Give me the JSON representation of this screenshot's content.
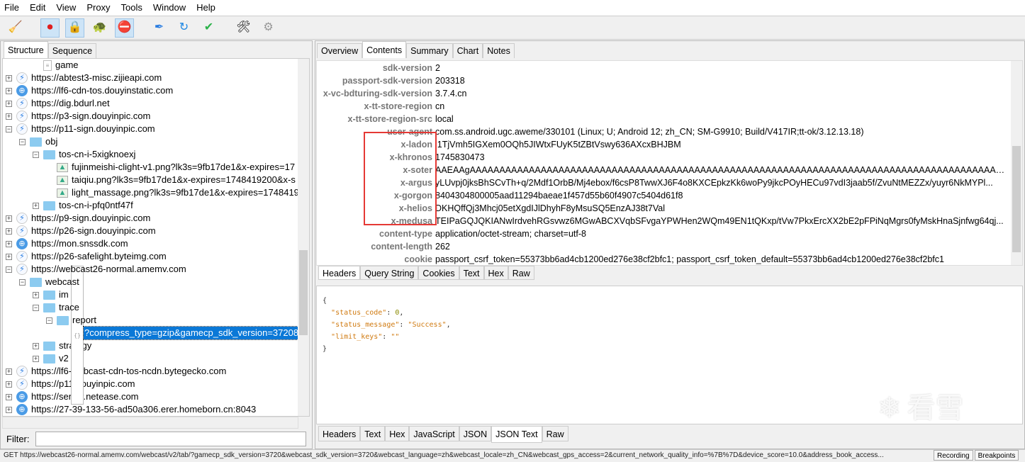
{
  "menu": [
    "File",
    "Edit",
    "View",
    "Proxy",
    "Tools",
    "Window",
    "Help"
  ],
  "toolbar": [
    {
      "icon": "broom-icon",
      "glyph": "🧹",
      "on": false
    },
    {
      "icon": "record-icon",
      "glyph": "⏺",
      "on": true,
      "color": "#e02020"
    },
    {
      "icon": "ssl-lock-icon",
      "glyph": "🔒",
      "on": true
    },
    {
      "icon": "throttle-turtle-icon",
      "glyph": "🐢",
      "on": false
    },
    {
      "icon": "breakpoint-stop-icon",
      "glyph": "⛔",
      "on": true
    },
    {
      "icon": "compose-pen-icon",
      "glyph": "✒",
      "on": false,
      "color": "#2a7de1"
    },
    {
      "icon": "repeat-refresh-icon",
      "glyph": "↻",
      "on": false,
      "color": "#1b86e3"
    },
    {
      "icon": "validate-check-icon",
      "glyph": "✔",
      "on": false,
      "color": "#2cb34a"
    },
    {
      "icon": "tools-icon",
      "glyph": "🛠",
      "on": false
    },
    {
      "icon": "settings-gear-icon",
      "glyph": "⚙",
      "on": false,
      "color": "#999"
    }
  ],
  "left": {
    "tabs": [
      "Structure",
      "Sequence"
    ],
    "tree": [
      {
        "label": "game",
        "level": 2,
        "exp": "",
        "icon": "doc"
      },
      {
        "label": "https://abtest3-misc.zijieapi.com",
        "level": 0,
        "exp": "+",
        "icon": "bolt"
      },
      {
        "label": "https://lf6-cdn-tos.douyinstatic.com",
        "level": 0,
        "exp": "+",
        "icon": "globe"
      },
      {
        "label": "https://dig.bdurl.net",
        "level": 0,
        "exp": "+",
        "icon": "bolt"
      },
      {
        "label": "https://p3-sign.douyinpic.com",
        "level": 0,
        "exp": "+",
        "icon": "bolt"
      },
      {
        "label": "https://p11-sign.douyinpic.com",
        "level": 0,
        "exp": "−",
        "icon": "bolt"
      },
      {
        "label": "obj",
        "level": 1,
        "exp": "−",
        "icon": "folder"
      },
      {
        "label": "tos-cn-i-5xigknoexj",
        "level": 2,
        "exp": "−",
        "icon": "folder"
      },
      {
        "label": "fujinmeishi-clight-v1.png?lk3s=9fb17de1&x-expires=17",
        "level": 3,
        "exp": "",
        "icon": "image"
      },
      {
        "label": "taiqiu.png?lk3s=9fb17de1&x-expires=1748419200&x-s",
        "level": 3,
        "exp": "",
        "icon": "image"
      },
      {
        "label": "light_massage.png?lk3s=9fb17de1&x-expires=1748419",
        "level": 3,
        "exp": "",
        "icon": "image"
      },
      {
        "label": "tos-cn-i-pfq0ntf47f",
        "level": 2,
        "exp": "+",
        "icon": "folder"
      },
      {
        "label": "https://p9-sign.douyinpic.com",
        "level": 0,
        "exp": "+",
        "icon": "bolt"
      },
      {
        "label": "https://p26-sign.douyinpic.com",
        "level": 0,
        "exp": "+",
        "icon": "bolt"
      },
      {
        "label": "https://mon.snssdk.com",
        "level": 0,
        "exp": "+",
        "icon": "globe"
      },
      {
        "label": "https://p26-safelight.byteimg.com",
        "level": 0,
        "exp": "+",
        "icon": "bolt"
      },
      {
        "label": "https://webcast26-normal.amemv.com",
        "level": 0,
        "exp": "−",
        "icon": "bolt"
      },
      {
        "label": "webcast",
        "level": 1,
        "exp": "−",
        "icon": "folder"
      },
      {
        "label": "im",
        "level": 2,
        "exp": "+",
        "icon": "folder"
      },
      {
        "label": "trace",
        "level": 2,
        "exp": "−",
        "icon": "folder"
      },
      {
        "label": "report",
        "level": 3,
        "exp": "−",
        "icon": "folder"
      },
      {
        "label": "?compress_type=gzip&gamecp_sdk_version=37208",
        "level": 4,
        "exp": "",
        "icon": "json",
        "selected": true
      },
      {
        "label": "strategy",
        "level": 2,
        "exp": "+",
        "icon": "folder"
      },
      {
        "label": "v2",
        "level": 2,
        "exp": "+",
        "icon": "folder"
      },
      {
        "label": "https://lf6-webcast-cdn-tos-ncdn.bytegecko.com",
        "level": 0,
        "exp": "+",
        "icon": "bolt"
      },
      {
        "label": "https://p11.douyinpic.com",
        "level": 0,
        "exp": "+",
        "icon": "bolt"
      },
      {
        "label": "https://sentry.netease.com",
        "level": 0,
        "exp": "+",
        "icon": "globe"
      },
      {
        "label": "https://27-39-133-56-ad50a306.erer.homeborn.cn:8043",
        "level": 0,
        "exp": "+",
        "icon": "globe"
      }
    ],
    "filter_label": "Filter:",
    "filter_value": ""
  },
  "right": {
    "tabs": [
      "Overview",
      "Contents",
      "Summary",
      "Chart",
      "Notes"
    ],
    "selected_tab": "Contents",
    "headers": [
      [
        "sdk-version",
        "2"
      ],
      [
        "passport-sdk-version",
        "203318"
      ],
      [
        "x-vc-bdturing-sdk-version",
        "3.7.4.cn"
      ],
      [
        "x-tt-store-region",
        "cn"
      ],
      [
        "x-tt-store-region-src",
        "local"
      ],
      [
        "user-agent",
        "com.ss.android.ugc.aweme/330101 (Linux; U; Android 12; zh_CN; SM-G9910; Build/V417IR;tt-ok/3.12.13.18)"
      ],
      [
        "x-ladon",
        "l1TjVmh5IGXem0OQh5JIWtxFUyK5tZBtVswy636AXcxBHJBM"
      ],
      [
        "x-khronos",
        "1745830473"
      ],
      [
        "x-soter",
        "AAEAAgAAAAAAAAAAAAAAAAAAAAAAAAAAAAAAAAAAAAAAAAAAAAAAAAAAAAAAAAAAAAAAAAAAAAAAAAAAAAAAAAAAAAAAAAAAAAAA..."
      ],
      [
        "x-argus",
        "yLUvpj0jksBhSCvTh+q/2Mdf1OrbB/Mj4ebox/f6csP8TwwXJ6F4o8KXCEpkzKk6woPy9jkcPOyHECu97vdI3jaab5f/ZvuNtMEZZx/yuyr6NkMYPl..."
      ],
      [
        "x-gorgon",
        "8404304800005aad11294baeae1f457d55b60f4907c5404d61f8"
      ],
      [
        "x-helios",
        "DKHQffQj3Mhcj05etXgdIJlDhyhF8yMsuSQ5EnzAJ38t7Val"
      ],
      [
        "x-medusa",
        "TEIPaGQJQKIANwIrdvehRGsvwz6MGwABCXVqbSFvgaYPWHen2WQm49EN1tQKxp/tVw7PkxErcXX2bE2pFPiNqMgrs0fyMskHnaSjnfwg64qj..."
      ],
      [
        "content-type",
        "application/octet-stream; charset=utf-8"
      ],
      [
        "content-length",
        "262"
      ],
      [
        "cookie",
        "passport_csrf_token=55373bb6ad4cb1200ed276e38cf2bfc1; passport_csrf_token_default=55373bb6ad4cb1200ed276e38cf2bfc1"
      ]
    ],
    "request_tabs": [
      "Headers",
      "Query String",
      "Cookies",
      "Text",
      "Hex",
      "Raw"
    ],
    "response_json": {
      "k1": "\"status_code\"",
      "v1": "0",
      "k2": "\"status_message\"",
      "v2": "\"Success\"",
      "k3": "\"limit_keys\"",
      "v3": "\"\""
    },
    "response_tabs": [
      "Headers",
      "Text",
      "Hex",
      "JavaScript",
      "JSON",
      "JSON Text",
      "Raw"
    ],
    "selected_response_tab": "JSON Text"
  },
  "status": {
    "url": "GET https://webcast26-normal.amemv.com/webcast/v2/tab/?gamecp_sdk_version=3720&webcast_sdk_version=3720&webcast_language=zh&webcast_locale=zh_CN&webcast_gps_access=2&current_network_quality_info=%7B%7D&device_score=10.0&address_book_access...",
    "recording": "Recording",
    "breakpoints": "Breakpoints"
  },
  "watermark": "看雪",
  "colors": {
    "highlight_box": "#e53935",
    "selection": "#0a78d7"
  }
}
